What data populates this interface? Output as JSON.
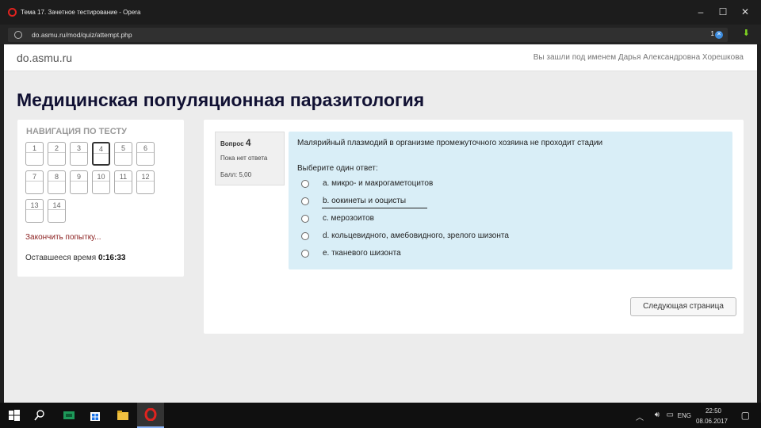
{
  "window": {
    "title": "Тема 17. Зачетное тестирование - Opera",
    "url": "do.asmu.ru/mod/quiz/attempt.php",
    "badge_count": "1"
  },
  "site": {
    "brand": "do.asmu.ru",
    "login_info": "Вы зашли под именем Дарья Александровна Хорешкова",
    "page_title": "Медицинская популяционная паразитология"
  },
  "nav": {
    "title": "НАВИГАЦИЯ ПО ТЕСТУ",
    "questions": [
      "1",
      "2",
      "3",
      "4",
      "5",
      "6",
      "7",
      "8",
      "9",
      "10",
      "11",
      "12",
      "13",
      "14"
    ],
    "current_question": "4",
    "finish_link": "Закончить попытку...",
    "time_label": "Оставшееся время",
    "time_value": "0:16:33"
  },
  "question": {
    "label": "Вопрос",
    "number": "4",
    "status": "Пока нет ответа",
    "grade": "Балл: 5,00",
    "text": "Малярийный плазмодий в организме промежуточного хозяина не проходит стадии",
    "prompt": "Выберите один ответ:",
    "answers": [
      "a. микро- и макрогаметоцитов",
      "b. оокинеты и ооцисты",
      "c. мерозоитов",
      "d. кольцевидного, амебовидного, зрелого шизонта",
      "e. тканевого шизонта"
    ],
    "next_button": "Следующая страница"
  },
  "taskbar": {
    "language": "ENG",
    "time": "22:50",
    "date": "08.06.2017"
  },
  "colors": {
    "question_bg": "#d9eef7",
    "finish_link": "#8b2020",
    "title_color": "#111133"
  }
}
